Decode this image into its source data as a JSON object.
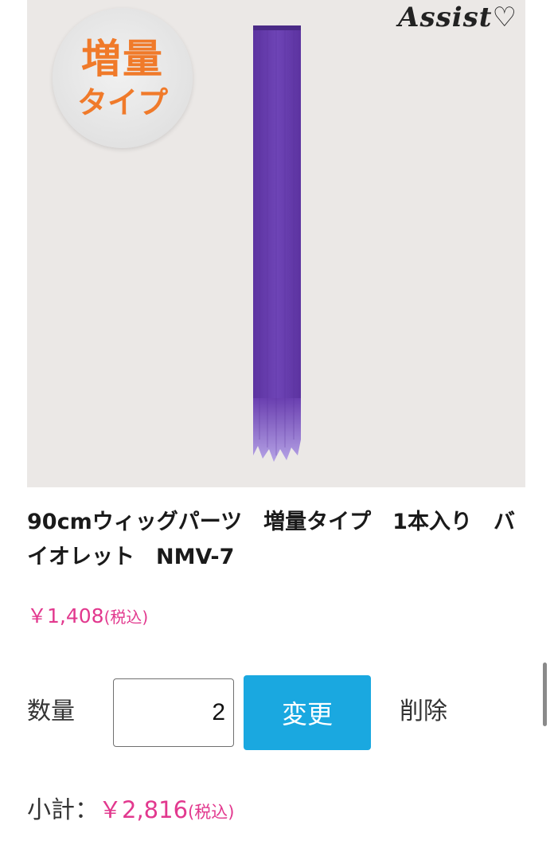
{
  "product_image": {
    "badge_line1": "増量",
    "badge_line2": "タイプ",
    "brand_logo": "Assist",
    "hair_color": "#6a3fb0",
    "hair_tip_color": "#b6a4e6",
    "background_color": "#ebe8e6"
  },
  "product": {
    "title": "90cmウィッグパーツ　増量タイプ　1本入り　バイオレット　NMV-7",
    "unit_price": "￥1,408",
    "unit_price_tax": "(税込)"
  },
  "quantity": {
    "label": "数量",
    "value": "2",
    "update_label": "変更",
    "delete_label": "削除"
  },
  "subtotal": {
    "label": "小計：",
    "value": "￥2,816",
    "tax": "(税込)"
  },
  "colors": {
    "price": "#e2388e",
    "button": "#1aa8e0",
    "badge_text": "#f07a2a"
  }
}
